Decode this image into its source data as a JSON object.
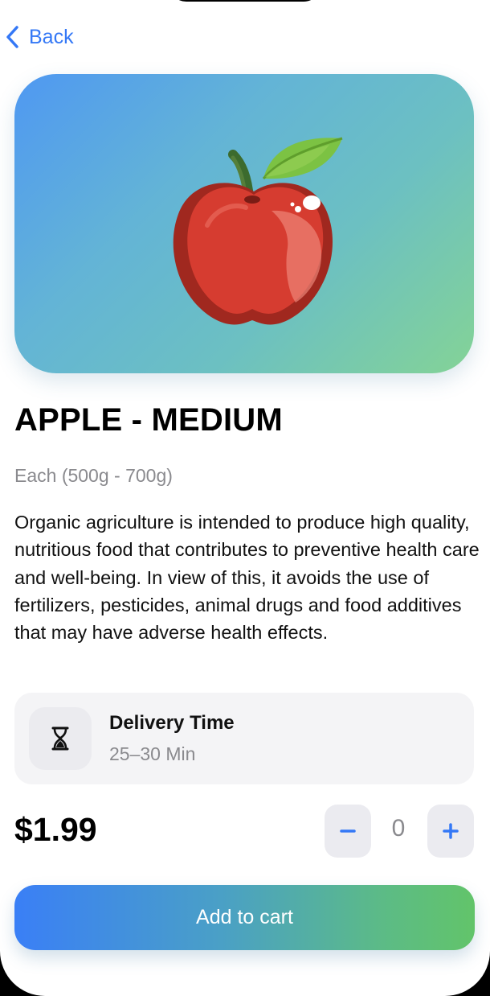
{
  "nav": {
    "back_label": "Back",
    "back_icon": "chevron-left-icon"
  },
  "product": {
    "image_icon": "apple-icon",
    "name": "APPLE - MEDIUM",
    "unit": "Each (500g - 700g)",
    "description": "Organic agriculture is intended to produce high quality, nutritious food that contributes to preventive health care and well-being. In view of this, it avoids the use of fertilizers, pesticides, animal drugs and food additives that may have adverse health effects."
  },
  "delivery": {
    "icon": "hourglass-icon",
    "title": "Delivery Time",
    "value": "25–30 Min"
  },
  "pricing": {
    "price": "$1.99",
    "quantity": "0",
    "decrement_icon": "minus-icon",
    "increment_icon": "plus-icon"
  },
  "actions": {
    "add_to_cart": "Add to cart"
  },
  "colors": {
    "accent": "#3478f6",
    "muted_text": "#8a8a8e",
    "card_bg": "#f4f4f6",
    "gradient_start": "#3a7ff6",
    "gradient_end": "#62c46a"
  }
}
